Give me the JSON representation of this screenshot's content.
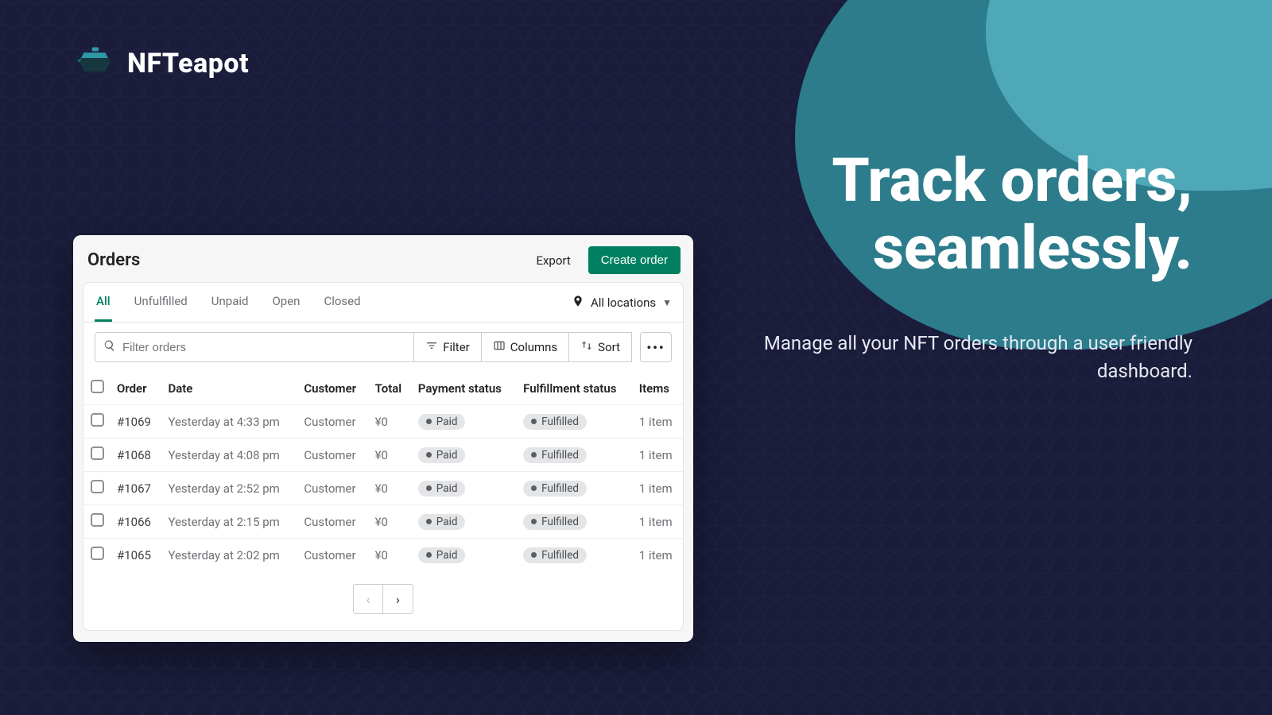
{
  "brand": {
    "name": "NFTeapot"
  },
  "hero": {
    "title_line1": "Track orders,",
    "title_line2": "seamlessly.",
    "subtitle": "Manage all your NFT orders through a user friendly dashboard."
  },
  "orders_panel": {
    "title": "Orders",
    "export_label": "Export",
    "create_label": "Create order",
    "tabs": [
      "All",
      "Unfulfilled",
      "Unpaid",
      "Open",
      "Closed"
    ],
    "active_tab": "All",
    "location_label": "All locations",
    "search_placeholder": "Filter orders",
    "toolbar": {
      "filter": "Filter",
      "columns": "Columns",
      "sort": "Sort"
    },
    "columns": [
      "Order",
      "Date",
      "Customer",
      "Total",
      "Payment status",
      "Fulfillment status",
      "Items"
    ],
    "rows": [
      {
        "order": "#1069",
        "date": "Yesterday at 4:33 pm",
        "customer": "Customer",
        "total": "¥0",
        "payment": "Paid",
        "fulfillment": "Fulfilled",
        "items": "1 item"
      },
      {
        "order": "#1068",
        "date": "Yesterday at 4:08 pm",
        "customer": "Customer",
        "total": "¥0",
        "payment": "Paid",
        "fulfillment": "Fulfilled",
        "items": "1 item"
      },
      {
        "order": "#1067",
        "date": "Yesterday at 2:52 pm",
        "customer": "Customer",
        "total": "¥0",
        "payment": "Paid",
        "fulfillment": "Fulfilled",
        "items": "1 item"
      },
      {
        "order": "#1066",
        "date": "Yesterday at 2:15 pm",
        "customer": "Customer",
        "total": "¥0",
        "payment": "Paid",
        "fulfillment": "Fulfilled",
        "items": "1 item"
      },
      {
        "order": "#1065",
        "date": "Yesterday at 2:02 pm",
        "customer": "Customer",
        "total": "¥0",
        "payment": "Paid",
        "fulfillment": "Fulfilled",
        "items": "1 item"
      }
    ]
  }
}
